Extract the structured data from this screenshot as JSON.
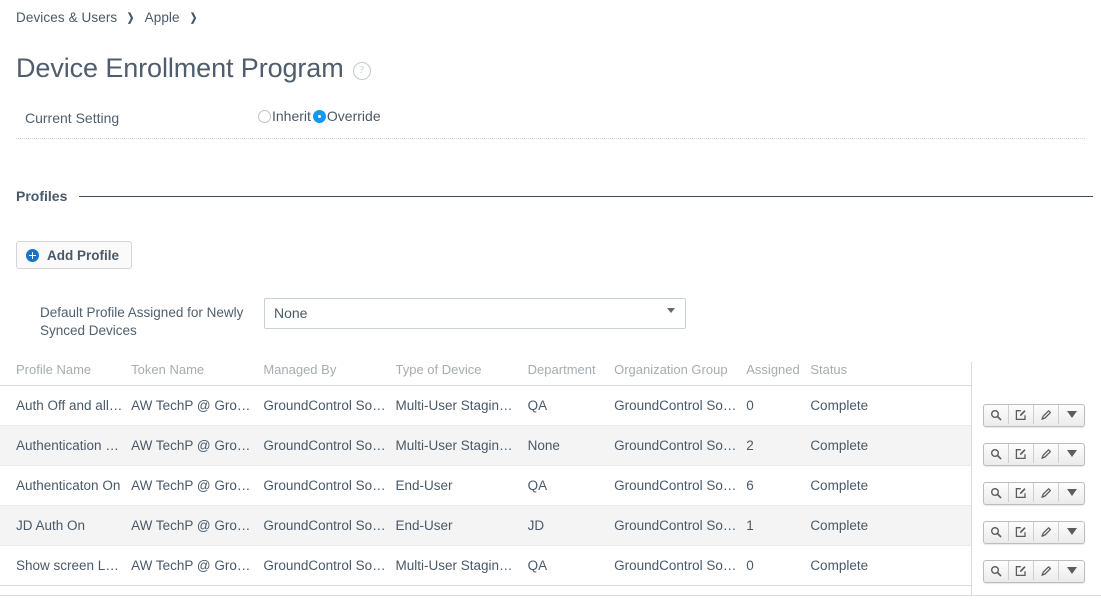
{
  "breadcrumb": {
    "items": [
      {
        "label": "Devices & Users"
      },
      {
        "label": "Apple"
      }
    ],
    "separator": "❯"
  },
  "header": {
    "title": "Device Enrollment Program",
    "help_icon": "help-circle-icon",
    "help_glyph": "?"
  },
  "current_setting": {
    "label": "Current Setting",
    "options": [
      {
        "label": "Inherit",
        "selected": false
      },
      {
        "label": "Override",
        "selected": true
      }
    ],
    "selected_value": "Override",
    "accent_color": "#0f9aef"
  },
  "profiles_section": {
    "title": "Profiles",
    "add_button": {
      "label": "Add Profile",
      "icon": "plus-circle-icon",
      "icon_color": "#1a73c4"
    },
    "default_profile": {
      "label": "Default Profile Assigned for Newly Synced Devices",
      "value": "None",
      "placeholder": "None",
      "options": [
        "None"
      ]
    }
  },
  "table": {
    "columns": [
      {
        "key": "profile_name",
        "label": "Profile Name"
      },
      {
        "key": "token_name",
        "label": "Token Name"
      },
      {
        "key": "managed_by",
        "label": "Managed By"
      },
      {
        "key": "type_of_device",
        "label": "Type of Device"
      },
      {
        "key": "department",
        "label": "Department"
      },
      {
        "key": "organization_group",
        "label": "Organization Group"
      },
      {
        "key": "assigned",
        "label": "Assigned"
      },
      {
        "key": "status",
        "label": "Status"
      }
    ],
    "rows": [
      {
        "profile_name": "Auth Off and allo…",
        "token_name": "AW TechP @ Grou…",
        "managed_by": "GroundControl So…",
        "type_of_device": "Multi-User Stagin…",
        "department": "QA",
        "organization_group": "GroundControl So…",
        "assigned": "0",
        "status": "Complete"
      },
      {
        "profile_name": "Authentication OFF",
        "token_name": "AW TechP @ Grou…",
        "managed_by": "GroundControl So…",
        "type_of_device": "Multi-User Stagin…",
        "department": "None",
        "organization_group": "GroundControl So…",
        "assigned": "2",
        "status": "Complete"
      },
      {
        "profile_name": "Authenticaton On",
        "token_name": "AW TechP @ Grou…",
        "managed_by": "GroundControl So…",
        "type_of_device": "End-User",
        "department": "QA",
        "organization_group": "GroundControl So…",
        "assigned": "6",
        "status": "Complete"
      },
      {
        "profile_name": "JD Auth On",
        "token_name": "AW TechP @ Grou…",
        "managed_by": "GroundControl So…",
        "type_of_device": "End-User",
        "department": "JD",
        "organization_group": "GroundControl So…",
        "assigned": "1",
        "status": "Complete"
      },
      {
        "profile_name": "Show screen Loca…",
        "token_name": "AW TechP @ Grou…",
        "managed_by": "GroundControl So…",
        "type_of_device": "Multi-User Stagin…",
        "department": "QA",
        "organization_group": "GroundControl So…",
        "assigned": "0",
        "status": "Complete"
      }
    ],
    "row_actions": [
      {
        "name": "view-icon",
        "icon": "magnifier-icon"
      },
      {
        "name": "edit-box-icon",
        "icon": "square-pencil-icon"
      },
      {
        "name": "edit-icon",
        "icon": "pencil-icon"
      },
      {
        "name": "more-actions-icon",
        "icon": "caret-down-icon"
      }
    ]
  }
}
